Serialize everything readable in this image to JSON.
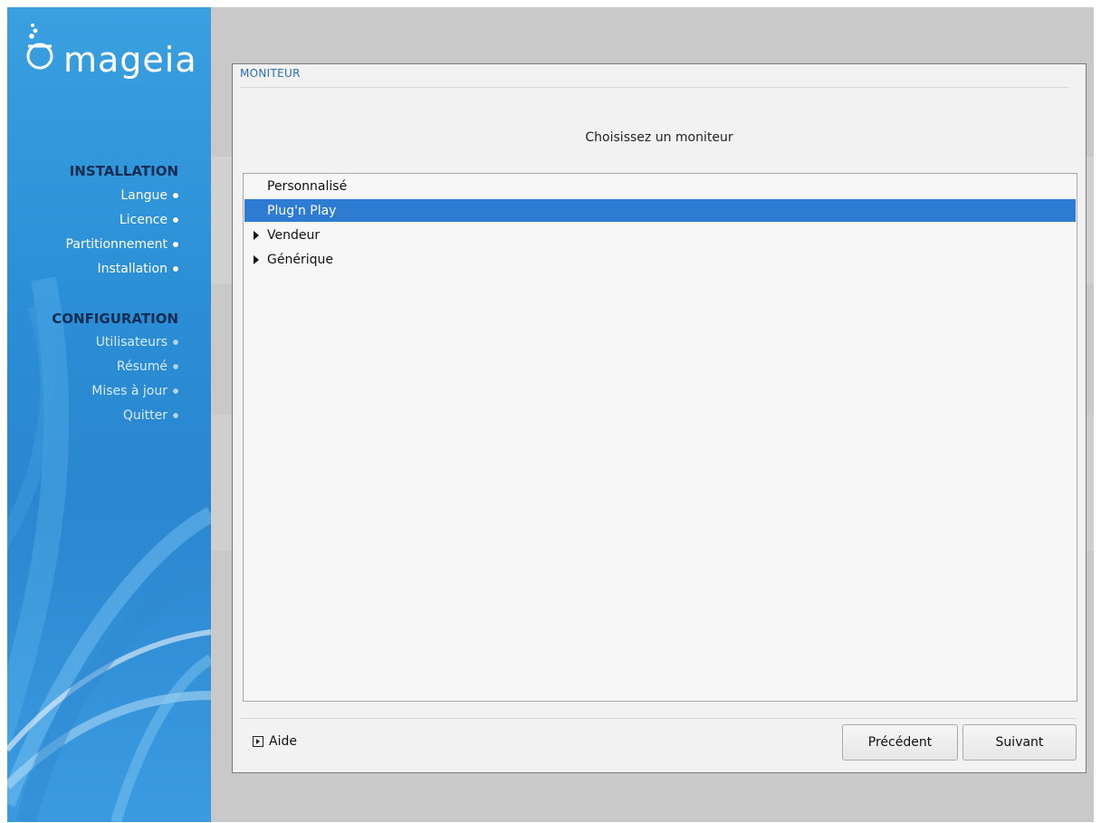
{
  "sidebar": {
    "logo_text": "mageia",
    "sections": [
      {
        "title": "INSTALLATION",
        "items": [
          {
            "label": "Langue",
            "state": "done"
          },
          {
            "label": "Licence",
            "state": "done"
          },
          {
            "label": "Partitionnement",
            "state": "done"
          },
          {
            "label": "Installation",
            "state": "done"
          }
        ]
      },
      {
        "title": "CONFIGURATION",
        "items": [
          {
            "label": "Utilisateurs",
            "state": "todo"
          },
          {
            "label": "Résumé",
            "state": "todo"
          },
          {
            "label": "Mises à jour",
            "state": "todo"
          },
          {
            "label": "Quitter",
            "state": "todo"
          }
        ]
      }
    ]
  },
  "dialog": {
    "title": "MONITEUR",
    "prompt": "Choisissez un moniteur",
    "list": [
      {
        "label": "Personnalisé",
        "expandable": false,
        "selected": false
      },
      {
        "label": "Plug'n Play",
        "expandable": false,
        "selected": true
      },
      {
        "label": "Vendeur",
        "expandable": true,
        "selected": false
      },
      {
        "label": "Générique",
        "expandable": true,
        "selected": false
      }
    ],
    "help_label": "Aide",
    "prev_label": "Précédent",
    "next_label": "Suivant"
  },
  "colors": {
    "selection": "#2e7bd4",
    "title_blue": "#2b6fb4",
    "sidebar_blue": "#2b8fd6",
    "section_title": "#0f2c52"
  }
}
